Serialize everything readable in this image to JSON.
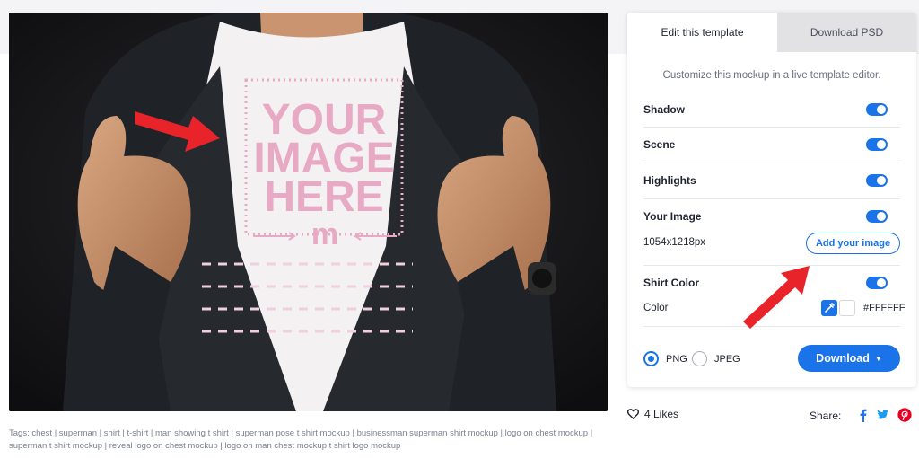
{
  "mockup": {
    "placeholder_lines": [
      "YOUR",
      "IMAGE",
      "HERE"
    ],
    "logo_glyph": "m"
  },
  "tags_text": "Tags: chest | superman | shirt | t-shirt | man showing t shirt | superman pose t shirt mockup | businessman superman shirt mockup | logo on chest mockup | superman t shirt mockup | reveal logo on chest mockup | logo on man chest mockup t shirt logo mockup",
  "tabs": [
    {
      "label": "Edit this template",
      "active": true
    },
    {
      "label": "Download PSD",
      "active": false
    }
  ],
  "editor": {
    "subtitle": "Customize this mockup in a live template editor.",
    "options": {
      "shadow": {
        "label": "Shadow",
        "enabled": true
      },
      "scene": {
        "label": "Scene",
        "enabled": true
      },
      "highlights": {
        "label": "Highlights",
        "enabled": true
      },
      "your_image": {
        "label": "Your Image",
        "enabled": true,
        "size": "1054x1218px",
        "add_button": "Add your image"
      },
      "shirt_color": {
        "label": "Shirt Color",
        "enabled": true,
        "color_label": "Color",
        "hex": "#FFFFFF"
      }
    },
    "formats": [
      {
        "label": "PNG",
        "selected": true
      },
      {
        "label": "JPEG",
        "selected": false
      }
    ],
    "download_label": "Download"
  },
  "footer": {
    "likes": "4 Likes",
    "share_label": "Share:",
    "social_icons": [
      "facebook-icon",
      "twitter-icon",
      "pinterest-icon"
    ]
  },
  "colors": {
    "accent": "#1a73e8",
    "arrow": "#e8242a",
    "placeholder_pink": "#e7a9c4",
    "pinterest": "#e60023",
    "facebook": "#1877f2",
    "twitter": "#1d9bf0"
  }
}
